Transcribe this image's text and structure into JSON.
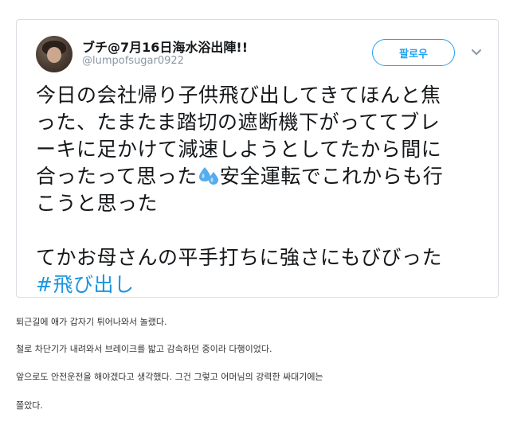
{
  "tweet": {
    "display_name": "ブチ@7月16日海水浴出陣!!",
    "handle": "@lumpofsugar0922",
    "follow_label": "팔로우",
    "caret_icon": "chevron-down-icon",
    "emoji_icon": "sweat-droplets-icon",
    "text": {
      "line1": "今日の会社帰り子供飛び出してきてほんと焦",
      "line2": "った、たまたま踏切の遮断機下がっててブレ",
      "line3": "ーキに足かけて減速しようとしてたから間に",
      "line4a": "合ったって思った",
      "line4b": "安全運転でこれからも行",
      "line5": "こうと思った",
      "line6": "てかお母さんの平手打ちに強さにもびびった",
      "hashtag": "#飛び出し"
    },
    "colors": {
      "accent": "#1da1f2",
      "hashtag": "#1b95e0",
      "border": "#d9dde1",
      "handle": "#8b98a5"
    }
  },
  "captions": {
    "p1": "퇴근길에 애가 갑자기 튀어나와서 놀랬다.",
    "p2": "철로 차단기가 내려와서 브레이크를 밟고 감속하던 중이라 다행이었다.",
    "p3": "앞으로도 안전운전을 해야겠다고 생각했다. 그건 그렇고 어머님의 강력한 싸대기에는",
    "p4": "쫄았다."
  }
}
